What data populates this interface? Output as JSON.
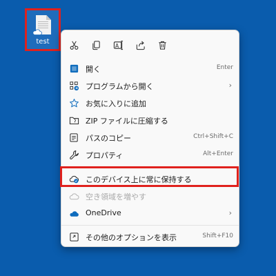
{
  "desktop": {
    "file_label": "test",
    "file_icon": "text-document-icon",
    "cloud_status_icon": "cloud-online-only-icon"
  },
  "menu": {
    "quick_actions": [
      {
        "name": "cut",
        "icon": "scissors-icon"
      },
      {
        "name": "copy",
        "icon": "copy-icon"
      },
      {
        "name": "rename",
        "icon": "rename-icon"
      },
      {
        "name": "share",
        "icon": "share-icon"
      },
      {
        "name": "delete",
        "icon": "trash-icon"
      }
    ],
    "items": {
      "open": {
        "label": "開く",
        "shortcut": "Enter",
        "icon": "open-book-icon"
      },
      "open_with": {
        "label": "プログラムから開く",
        "icon": "open-with-icon",
        "has_submenu": true
      },
      "favorites": {
        "label": "お気に入りに追加",
        "icon": "star-icon"
      },
      "zip": {
        "label": "ZIP ファイルに圧縮する",
        "icon": "zip-folder-icon"
      },
      "copy_path": {
        "label": "パスのコピー",
        "shortcut": "Ctrl+Shift+C",
        "icon": "copy-path-icon"
      },
      "properties": {
        "label": "プロパティ",
        "shortcut": "Alt+Enter",
        "icon": "wrench-icon"
      },
      "keep_on_device": {
        "label": "このデバイス上に常に保持する",
        "icon": "cloud-pin-icon"
      },
      "free_space": {
        "label": "空き領域を増やす",
        "icon": "cloud-outline-icon",
        "disabled": true
      },
      "onedrive": {
        "label": "OneDrive",
        "icon": "onedrive-icon",
        "has_submenu": true
      },
      "more_options": {
        "label": "その他のオプションを表示",
        "shortcut": "Shift+F10",
        "icon": "more-options-icon"
      }
    }
  },
  "colors": {
    "desktop_bg": "#0a5cad",
    "highlight_border": "#e0211d",
    "onedrive_blue": "#0f6cbd"
  }
}
